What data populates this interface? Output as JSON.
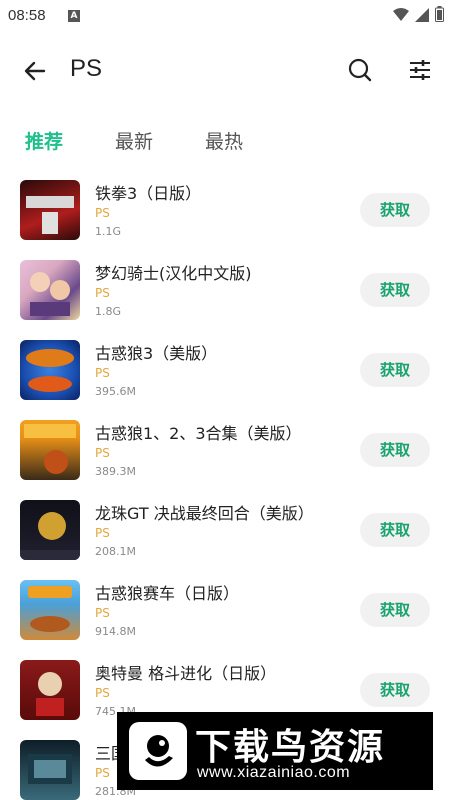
{
  "status_bar": {
    "time": "08:58",
    "notification_glyph": "A",
    "icons": [
      "wifi-icon",
      "signal-icon",
      "battery-icon"
    ]
  },
  "header": {
    "title": "PS",
    "back_icon": "arrow-left-icon",
    "search_icon": "search-icon",
    "filter_icon": "sliders-icon"
  },
  "tabs": [
    {
      "label": "推荐",
      "active": true
    },
    {
      "label": "最新",
      "active": false
    },
    {
      "label": "最热",
      "active": false
    }
  ],
  "games": [
    {
      "name": "铁拳3（日版）",
      "platform": "PS",
      "size": "1.1G",
      "button": "获取",
      "thumb_colors": [
        "#2a0a0a",
        "#b01d1d"
      ]
    },
    {
      "name": "梦幻骑士(汉化中文版)",
      "platform": "PS",
      "size": "1.8G",
      "button": "获取",
      "thumb_colors": [
        "#d9a7c0",
        "#6a4a8a"
      ]
    },
    {
      "name": "古惑狼3（美版）",
      "platform": "PS",
      "size": "395.6M",
      "button": "获取",
      "thumb_colors": [
        "#1a4fb0",
        "#e07b1a"
      ]
    },
    {
      "name": "古惑狼1、2、3合集（美版）",
      "platform": "PS",
      "size": "389.3M",
      "button": "获取",
      "thumb_colors": [
        "#e89018",
        "#3a2a18"
      ]
    },
    {
      "name": "龙珠GT 决战最终回合（美版）",
      "platform": "PS",
      "size": "208.1M",
      "button": "获取",
      "thumb_colors": [
        "#101018",
        "#d0a030"
      ]
    },
    {
      "name": "古惑狼赛车（日版）",
      "platform": "PS",
      "size": "914.8M",
      "button": "获取",
      "thumb_colors": [
        "#4aa0d8",
        "#d08a3a"
      ]
    },
    {
      "name": "奥特曼 格斗进化（日版）",
      "platform": "PS",
      "size": "745.1M",
      "button": "获取",
      "thumb_colors": [
        "#8a1a1a",
        "#e8d0b0"
      ]
    },
    {
      "name": "三国志",
      "platform": "PS",
      "size": "281.8M",
      "button": "获取",
      "thumb_colors": [
        "#0e1e28",
        "#3a6a7a"
      ]
    }
  ],
  "watermark": {
    "title": "下载鸟资源",
    "url": "www.xiazainiao.com"
  },
  "colors": {
    "accent": "#1fc08c",
    "button_text": "#1aa36f",
    "platform": "#e3a83a",
    "size_text": "#8a8a8a"
  }
}
